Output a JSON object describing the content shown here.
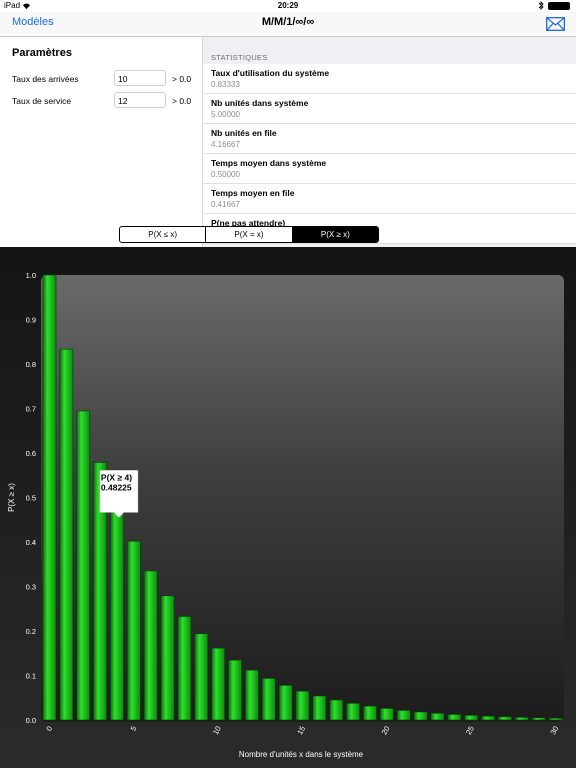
{
  "status": {
    "device": "iPad",
    "time": "20:29"
  },
  "nav": {
    "back_label": "Modèles",
    "title": "M/M/1/∞/∞"
  },
  "params": {
    "title": "Paramètres",
    "rows": [
      {
        "label": "Taux des arrivées",
        "value": "10",
        "constraint": "> 0.0"
      },
      {
        "label": "Taux de service",
        "value": "12",
        "constraint": "> 0.0"
      }
    ]
  },
  "stats": {
    "header": "STATISTIQUES",
    "items": [
      {
        "label": "Taux d'utilisation du système",
        "value": "0.83333"
      },
      {
        "label": "Nb unités dans système",
        "value": "5.00000"
      },
      {
        "label": "Nb unités en file",
        "value": "4.16667"
      },
      {
        "label": "Temps moyen dans système",
        "value": "0.50000"
      },
      {
        "label": "Temps moyen en file",
        "value": "0.41667"
      },
      {
        "label": "P(ne pas attendre)",
        "value": ""
      }
    ]
  },
  "segments": {
    "items": [
      "P(X ≤ x)",
      "P(X = x)",
      "P(X ≥ x)"
    ],
    "active_index": 2
  },
  "tooltip": {
    "label": "P(X ≥ 4)",
    "value": "0.48225"
  },
  "colors": {
    "bar": "#1fc01f",
    "chart_bg": "#222222",
    "accent": "#1a6ad8"
  },
  "chart_data": {
    "type": "bar",
    "xlabel": "Nombre d'unités x dans le système",
    "ylabel": "P(X ≥ x)",
    "ylim": [
      0,
      1
    ],
    "yticks": [
      "0.0",
      "0.1",
      "0.2",
      "0.3",
      "0.4",
      "0.5",
      "0.6",
      "0.7",
      "0.8",
      "0.9",
      "1.0"
    ],
    "xticks": [
      "0",
      "5",
      "10",
      "15",
      "20",
      "25",
      "30"
    ],
    "categories": [
      0,
      1,
      2,
      3,
      4,
      5,
      6,
      7,
      8,
      9,
      10,
      11,
      12,
      13,
      14,
      15,
      16,
      17,
      18,
      19,
      20,
      21,
      22,
      23,
      24,
      25,
      26,
      27,
      28,
      29,
      30
    ],
    "values": [
      1.0,
      0.83333,
      0.69444,
      0.5787,
      0.48225,
      0.40188,
      0.3349,
      0.27908,
      0.23257,
      0.19381,
      0.16151,
      0.13459,
      0.11216,
      0.09346,
      0.07789,
      0.06491,
      0.05409,
      0.04507,
      0.03756,
      0.0313,
      0.02608,
      0.02174,
      0.01811,
      0.01509,
      0.01258,
      0.01048,
      0.00874,
      0.00728,
      0.00607,
      0.00506,
      0.00421
    ]
  }
}
